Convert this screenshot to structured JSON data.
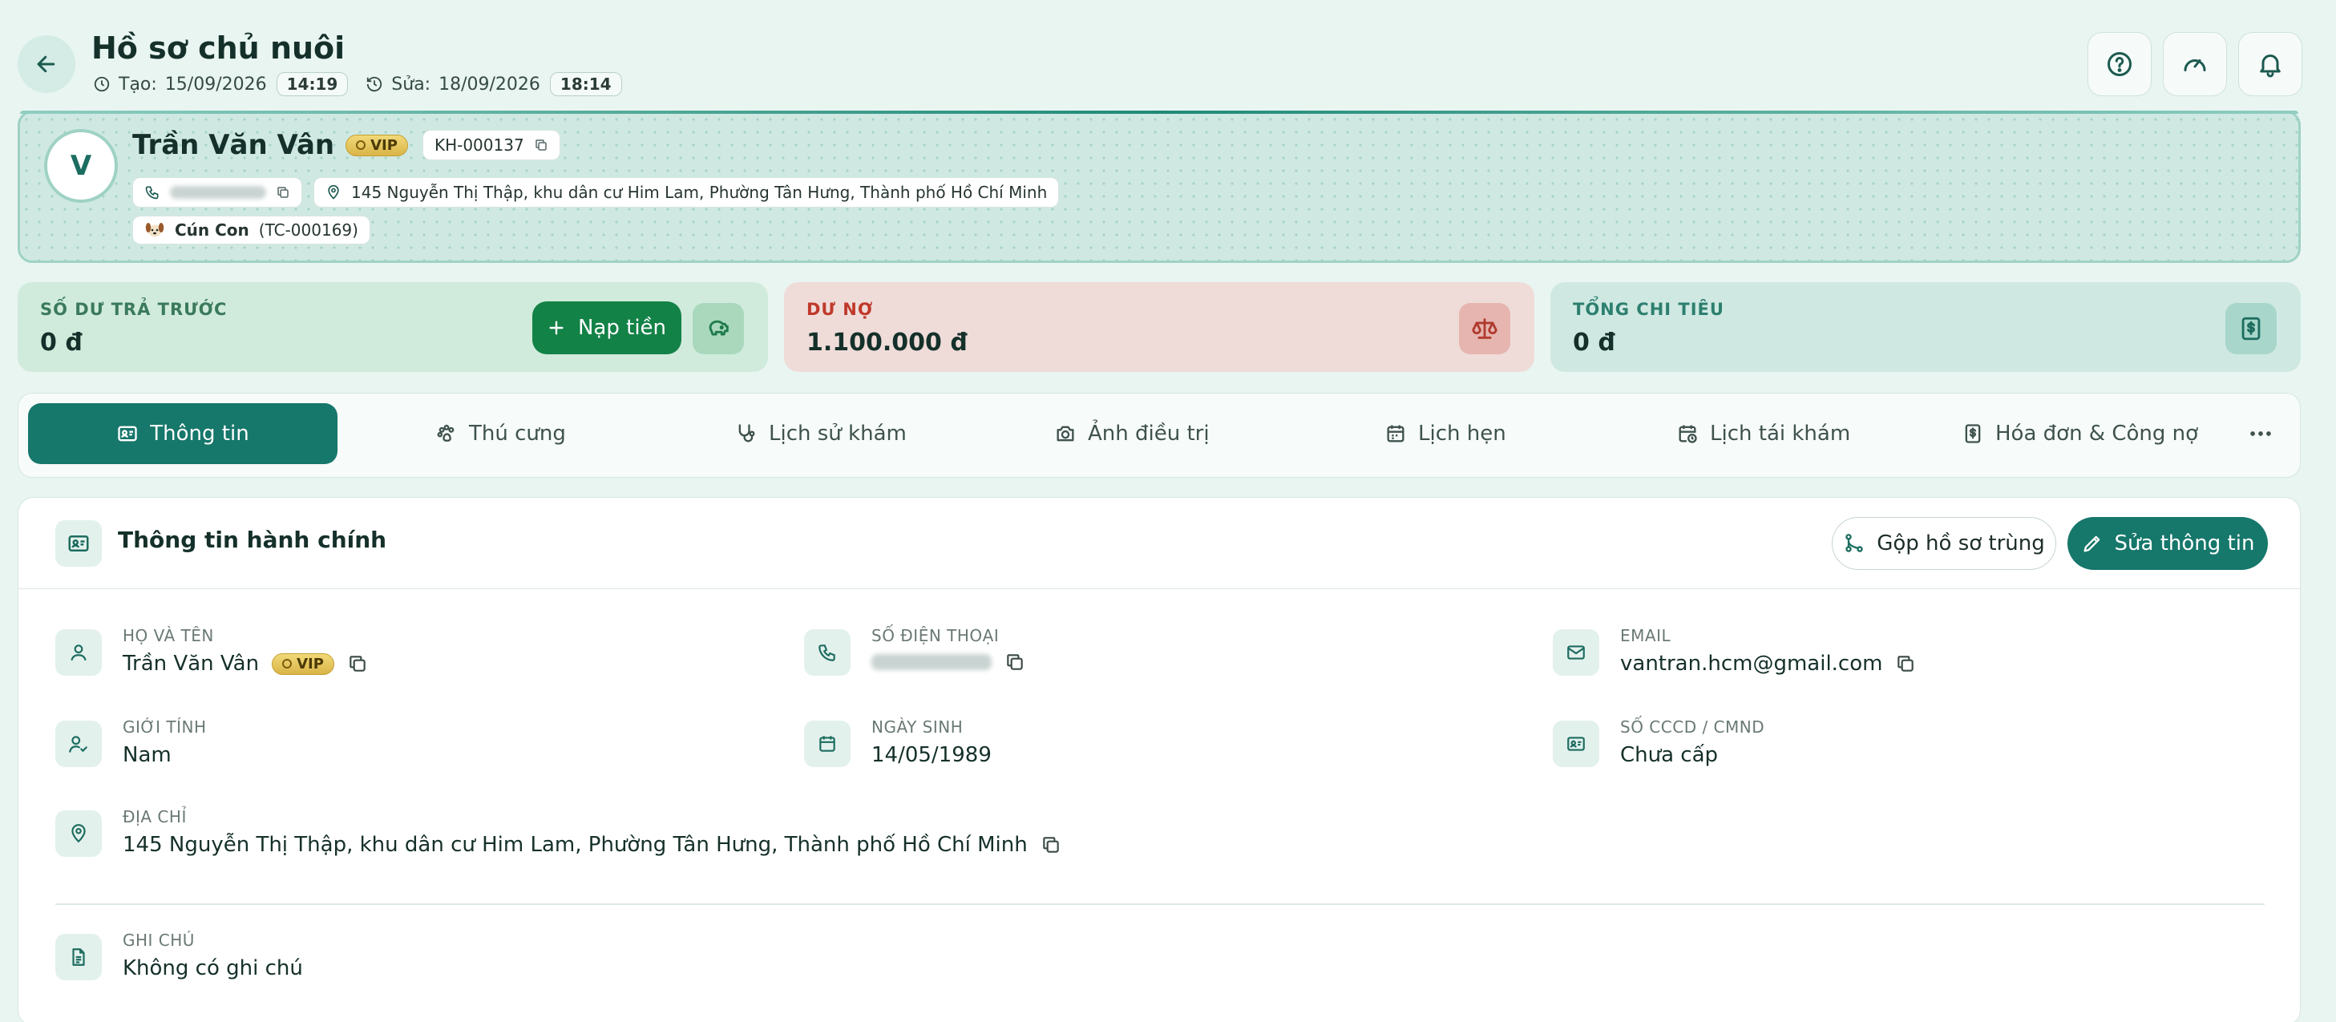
{
  "header": {
    "title": "Hồ sơ chủ nuôi",
    "created_label": "Tạo:",
    "created_date": "15/09/2026",
    "created_time": "14:19",
    "edited_label": "Sửa:",
    "edited_date": "18/09/2026",
    "edited_time": "18:14"
  },
  "profile": {
    "avatar_letter": "V",
    "name": "Trần Văn Vân",
    "vip": "VIP",
    "customer_code": "KH-000137",
    "address": "145 Nguyễn Thị Thập, khu dân cư Him Lam, Phường Tân Hưng, Thành phố Hồ Chí Minh",
    "pet_name": "Cún Con",
    "pet_code": "(TC-000169)"
  },
  "summary": {
    "prepaid": {
      "label": "SỐ DƯ TRẢ TRƯỚC",
      "value": "0 đ",
      "button": "Nạp tiền"
    },
    "debt": {
      "label": "DƯ NỢ",
      "value": "1.100.000 đ"
    },
    "total": {
      "label": "TỔNG CHI TIÊU",
      "value": "0 đ"
    }
  },
  "tabs": [
    {
      "label": "Thông tin",
      "icon": "id-card-icon"
    },
    {
      "label": "Thú cưng",
      "icon": "paw-icon"
    },
    {
      "label": "Lịch sử khám",
      "icon": "stethoscope-icon"
    },
    {
      "label": "Ảnh điều trị",
      "icon": "camera-icon"
    },
    {
      "label": "Lịch hẹn",
      "icon": "calendar-icon"
    },
    {
      "label": "Lịch tái khám",
      "icon": "calendar-clock-icon"
    },
    {
      "label": "Hóa đơn & Công nợ",
      "icon": "invoice-icon"
    }
  ],
  "panel": {
    "title": "Thông tin hành chính",
    "merge_button": "Gộp hồ sơ trùng",
    "edit_button": "Sửa thông tin",
    "fields": {
      "full_name": {
        "label": "HỌ VÀ TÊN",
        "value": "Trần Văn Vân"
      },
      "phone": {
        "label": "SỐ ĐIỆN THOẠI"
      },
      "email": {
        "label": "EMAIL",
        "value": "vantran.hcm@gmail.com"
      },
      "gender": {
        "label": "GIỚI TÍNH",
        "value": "Nam"
      },
      "birthday": {
        "label": "NGÀY SINH",
        "value": "14/05/1989"
      },
      "id_number": {
        "label": "SỐ CCCD / CMND",
        "value": "Chưa cấp"
      },
      "address": {
        "label": "ĐỊA CHỈ",
        "value": "145 Nguyễn Thị Thập, khu dân cư Him Lam, Phường Tân Hưng, Thành phố Hồ Chí Minh"
      },
      "note": {
        "label": "GHI CHÚ",
        "value": "Không có ghi chú"
      }
    }
  },
  "colors": {
    "accent": "#16776b",
    "topup": "#138247",
    "prepaid_bg": "#d0ebdc",
    "debt_bg": "#efdcd9",
    "total_bg": "#cfe9e2",
    "debt_text": "#c0392b"
  }
}
